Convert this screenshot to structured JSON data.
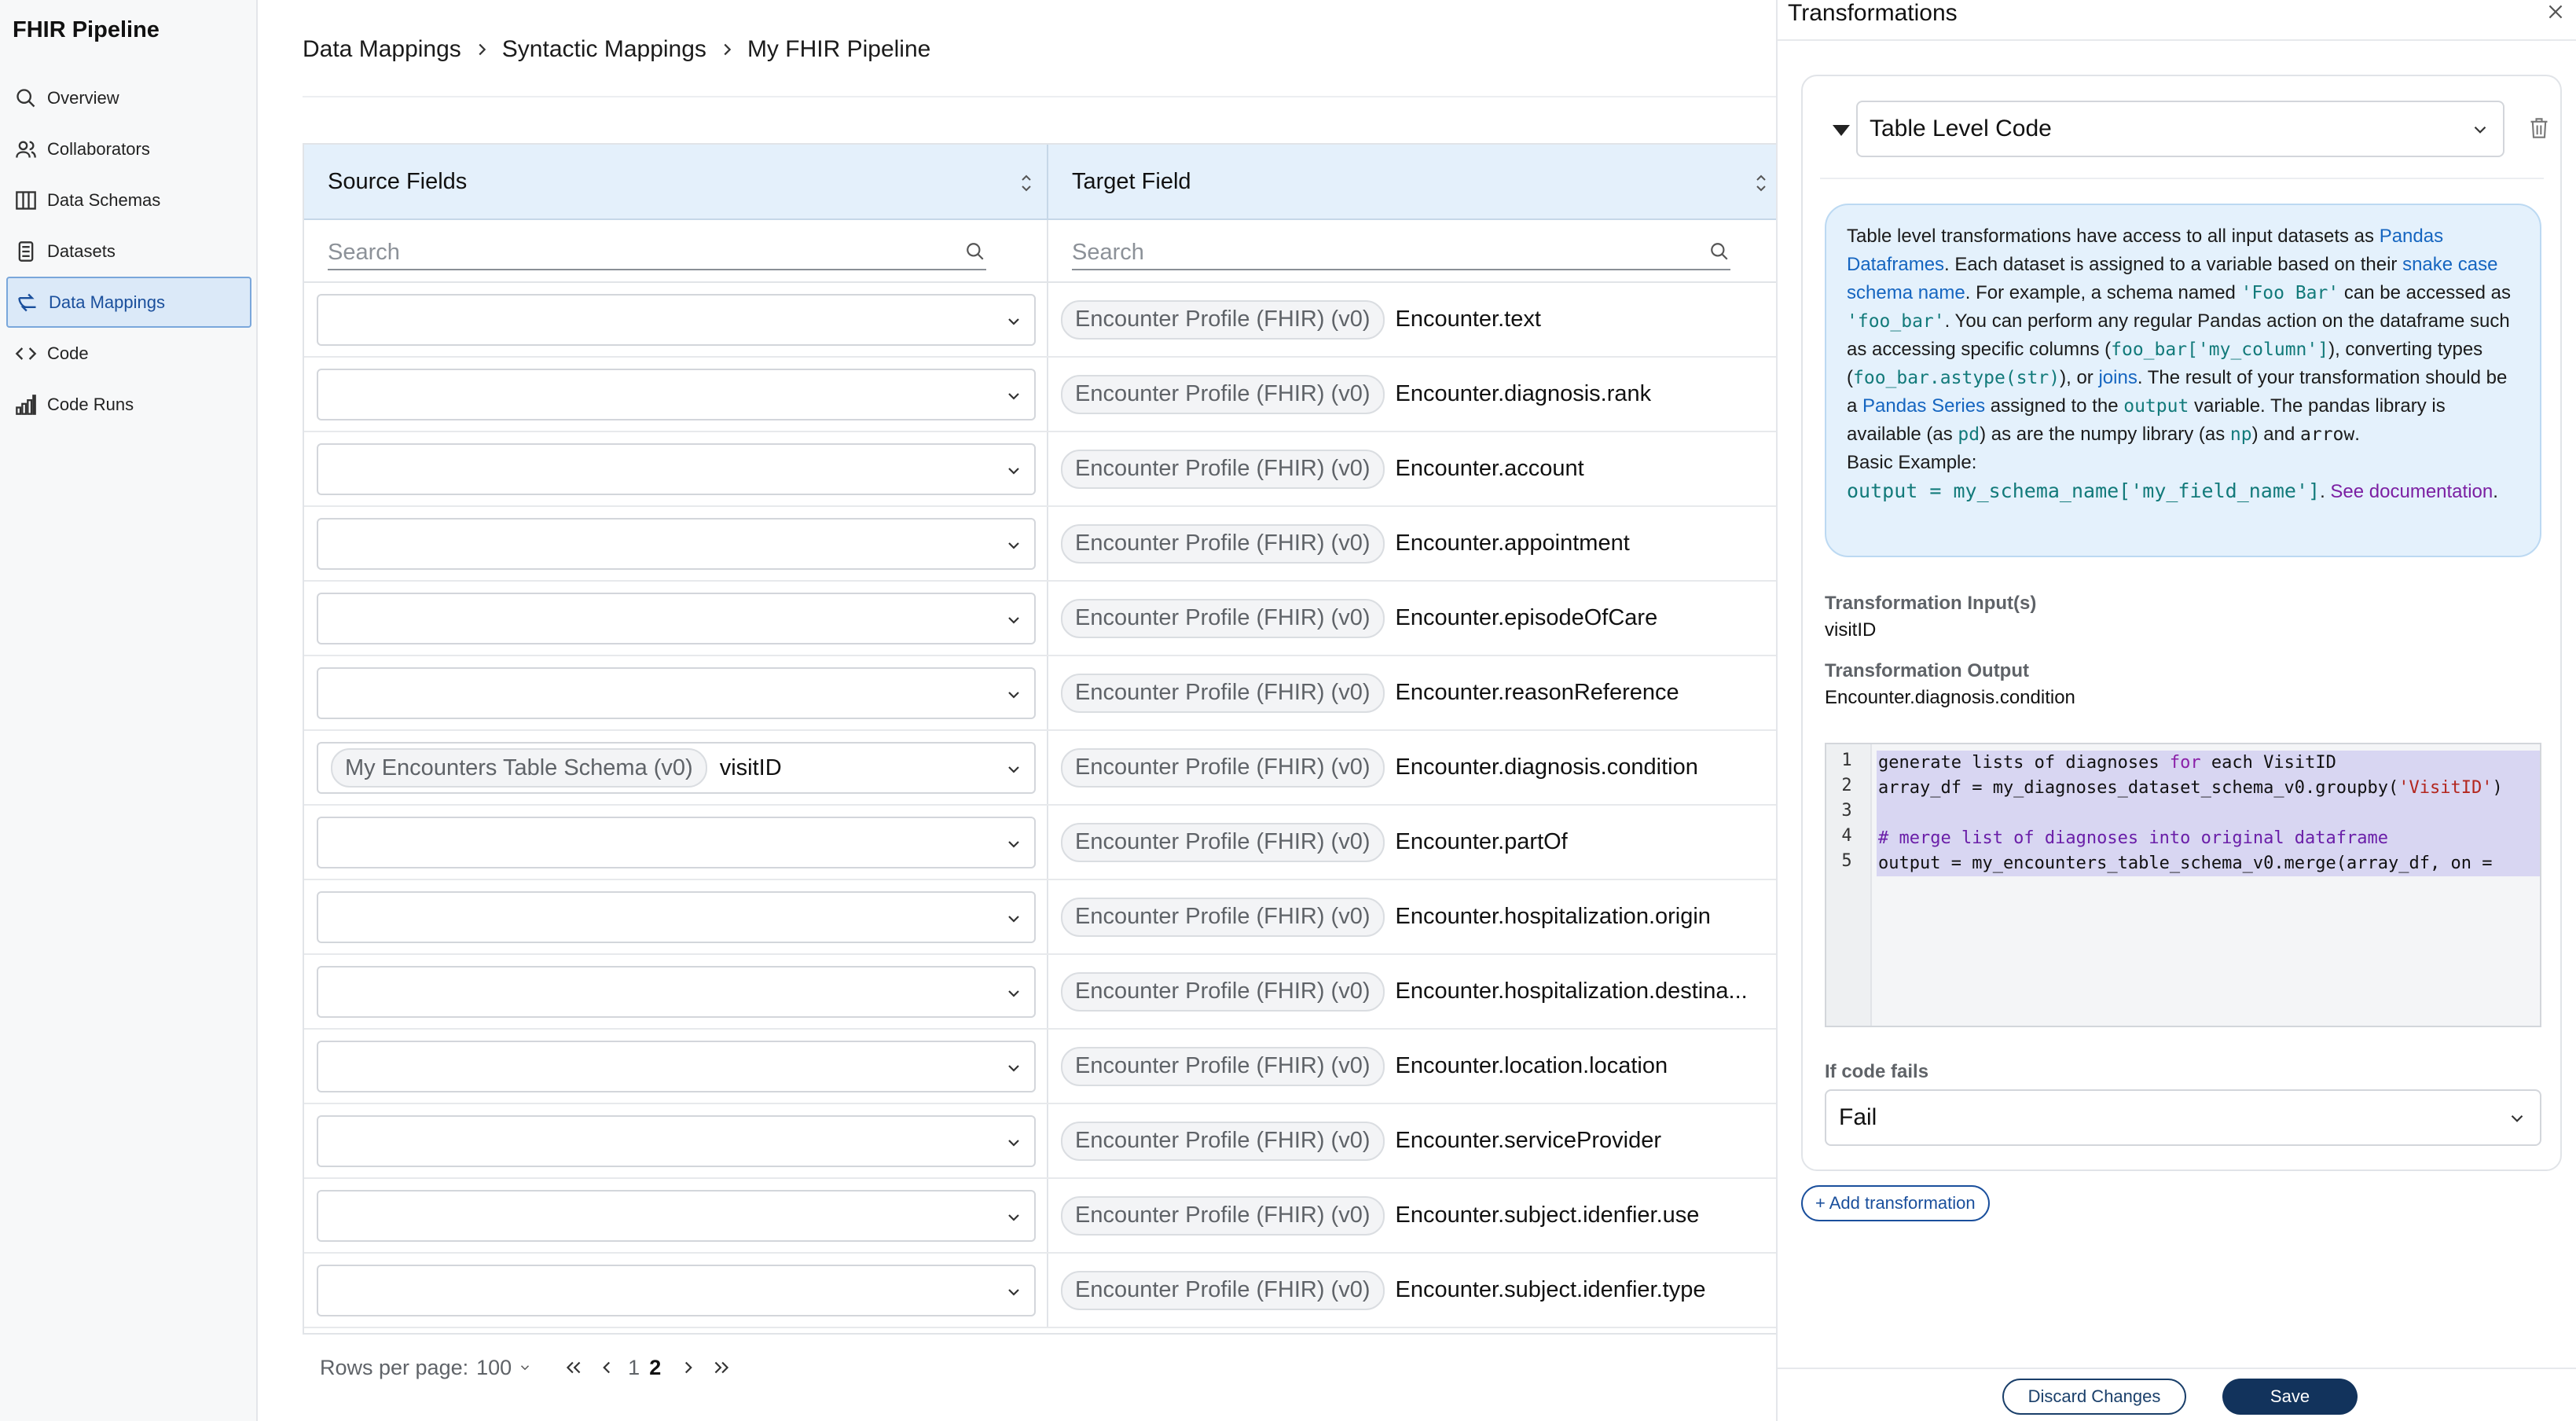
{
  "app": {
    "title": "FHIR Pipeline"
  },
  "sidebar": {
    "items": [
      {
        "label": "Overview",
        "icon": "search-icon"
      },
      {
        "label": "Collaborators",
        "icon": "users-icon"
      },
      {
        "label": "Data Schemas",
        "icon": "columns-icon"
      },
      {
        "label": "Datasets",
        "icon": "document-icon"
      },
      {
        "label": "Data Mappings",
        "icon": "mapping-icon",
        "active": true
      },
      {
        "label": "Code",
        "icon": "code-icon"
      },
      {
        "label": "Code Runs",
        "icon": "bar-chart-icon"
      }
    ]
  },
  "breadcrumb": [
    "Data Mappings",
    "Syntactic Mappings",
    "My FHIR Pipeline"
  ],
  "grid": {
    "source_header": "Source Fields",
    "target_header": "Target Field",
    "source_search_placeholder": "Search",
    "target_search_placeholder": "Search",
    "rows": [
      {
        "source_schema": "",
        "source_field": "",
        "target_schema": "Encounter Profile (FHIR) (v0)",
        "target_field": "Encounter.text"
      },
      {
        "source_schema": "",
        "source_field": "",
        "target_schema": "Encounter Profile (FHIR) (v0)",
        "target_field": "Encounter.diagnosis.rank"
      },
      {
        "source_schema": "",
        "source_field": "",
        "target_schema": "Encounter Profile (FHIR) (v0)",
        "target_field": "Encounter.account"
      },
      {
        "source_schema": "",
        "source_field": "",
        "target_schema": "Encounter Profile (FHIR) (v0)",
        "target_field": "Encounter.appointment"
      },
      {
        "source_schema": "",
        "source_field": "",
        "target_schema": "Encounter Profile (FHIR) (v0)",
        "target_field": "Encounter.episodeOfCare"
      },
      {
        "source_schema": "",
        "source_field": "",
        "target_schema": "Encounter Profile (FHIR) (v0)",
        "target_field": "Encounter.reasonReference"
      },
      {
        "source_schema": "My Encounters Table Schema (v0)",
        "source_field": "visitID",
        "target_schema": "Encounter Profile (FHIR) (v0)",
        "target_field": "Encounter.diagnosis.condition"
      },
      {
        "source_schema": "",
        "source_field": "",
        "target_schema": "Encounter Profile (FHIR) (v0)",
        "target_field": "Encounter.partOf"
      },
      {
        "source_schema": "",
        "source_field": "",
        "target_schema": "Encounter Profile (FHIR) (v0)",
        "target_field": "Encounter.hospitalization.origin"
      },
      {
        "source_schema": "",
        "source_field": "",
        "target_schema": "Encounter Profile (FHIR) (v0)",
        "target_field": "Encounter.hospitalization.destina..."
      },
      {
        "source_schema": "",
        "source_field": "",
        "target_schema": "Encounter Profile (FHIR) (v0)",
        "target_field": "Encounter.location.location"
      },
      {
        "source_schema": "",
        "source_field": "",
        "target_schema": "Encounter Profile (FHIR) (v0)",
        "target_field": "Encounter.serviceProvider"
      },
      {
        "source_schema": "",
        "source_field": "",
        "target_schema": "Encounter Profile (FHIR) (v0)",
        "target_field": "Encounter.subject.idenfier.use"
      },
      {
        "source_schema": "",
        "source_field": "",
        "target_schema": "Encounter Profile (FHIR) (v0)",
        "target_field": "Encounter.subject.idenfier.type"
      }
    ]
  },
  "pager": {
    "rows_per_page_label": "Rows per page:",
    "rows_per_page_value": "100",
    "pages": [
      "1",
      "2"
    ],
    "current_page": "2"
  },
  "panel": {
    "title": "Transformations",
    "transformation_type": "Table Level Code",
    "info": {
      "t1": "Table level transformations have access to all input datasets as ",
      "l1": "Pandas Dataframes",
      "t2": ". Each dataset is assigned to a variable based on their ",
      "l2": "snake case schema name",
      "t3": ". For example, a schema named ",
      "c1": "'Foo Bar'",
      "t4": " can be accessed as ",
      "c2": "'foo_bar'",
      "t5": ". You can perform any regular Pandas action on the dataframe such as accessing specific columns (",
      "c3": "foo_bar['my_column']",
      "t6": "), converting types (",
      "c4": "foo_bar.astype(str)",
      "t7": "), or ",
      "l3": "joins",
      "t8": ". The result of your transformation should be a ",
      "l4": "Pandas Series",
      "t9": " assigned to the ",
      "c5": "output",
      "t10": " variable. The pandas library is available (as ",
      "c6": "pd",
      "t11": ") as are the numpy library (as ",
      "c7": "np",
      "t12": ") and ",
      "c8": "arrow",
      "t13": ".",
      "example_label": "Basic Example:",
      "example_code": "output = my_schema_name['my_field_name']",
      "t14": ". ",
      "doc_link": "See documentation",
      "t15": "."
    },
    "inputs_label": "Transformation Input(s)",
    "inputs_value": "visitID",
    "output_label": "Transformation Output",
    "output_value": "Encounter.diagnosis.condition",
    "code": {
      "line_numbers": [
        "1",
        "2",
        "3",
        "4",
        "5"
      ],
      "l1_a": "generate lists of diagnoses ",
      "l1_kw": "for",
      "l1_b": " each VisitID",
      "l2_a": "array_df = my_diagnoses_dataset_schema_v0.groupby(",
      "l2_str": "'VisitID'",
      "l2_b": ")",
      "l3": "",
      "l4": "# merge list of diagnoses into original dataframe",
      "l5": "output = my_encounters_table_schema_v0.merge(array_df, on ="
    },
    "fail_label": "If code fails",
    "fail_value": "Fail",
    "add_transformation": "+ Add transformation",
    "discard": "Discard Changes",
    "save": "Save"
  },
  "colors": {
    "accent": "#1a4f9c",
    "header_bg": "#e4f0fb",
    "info_bg": "#e4f1fc",
    "save_bg": "#12335c"
  }
}
